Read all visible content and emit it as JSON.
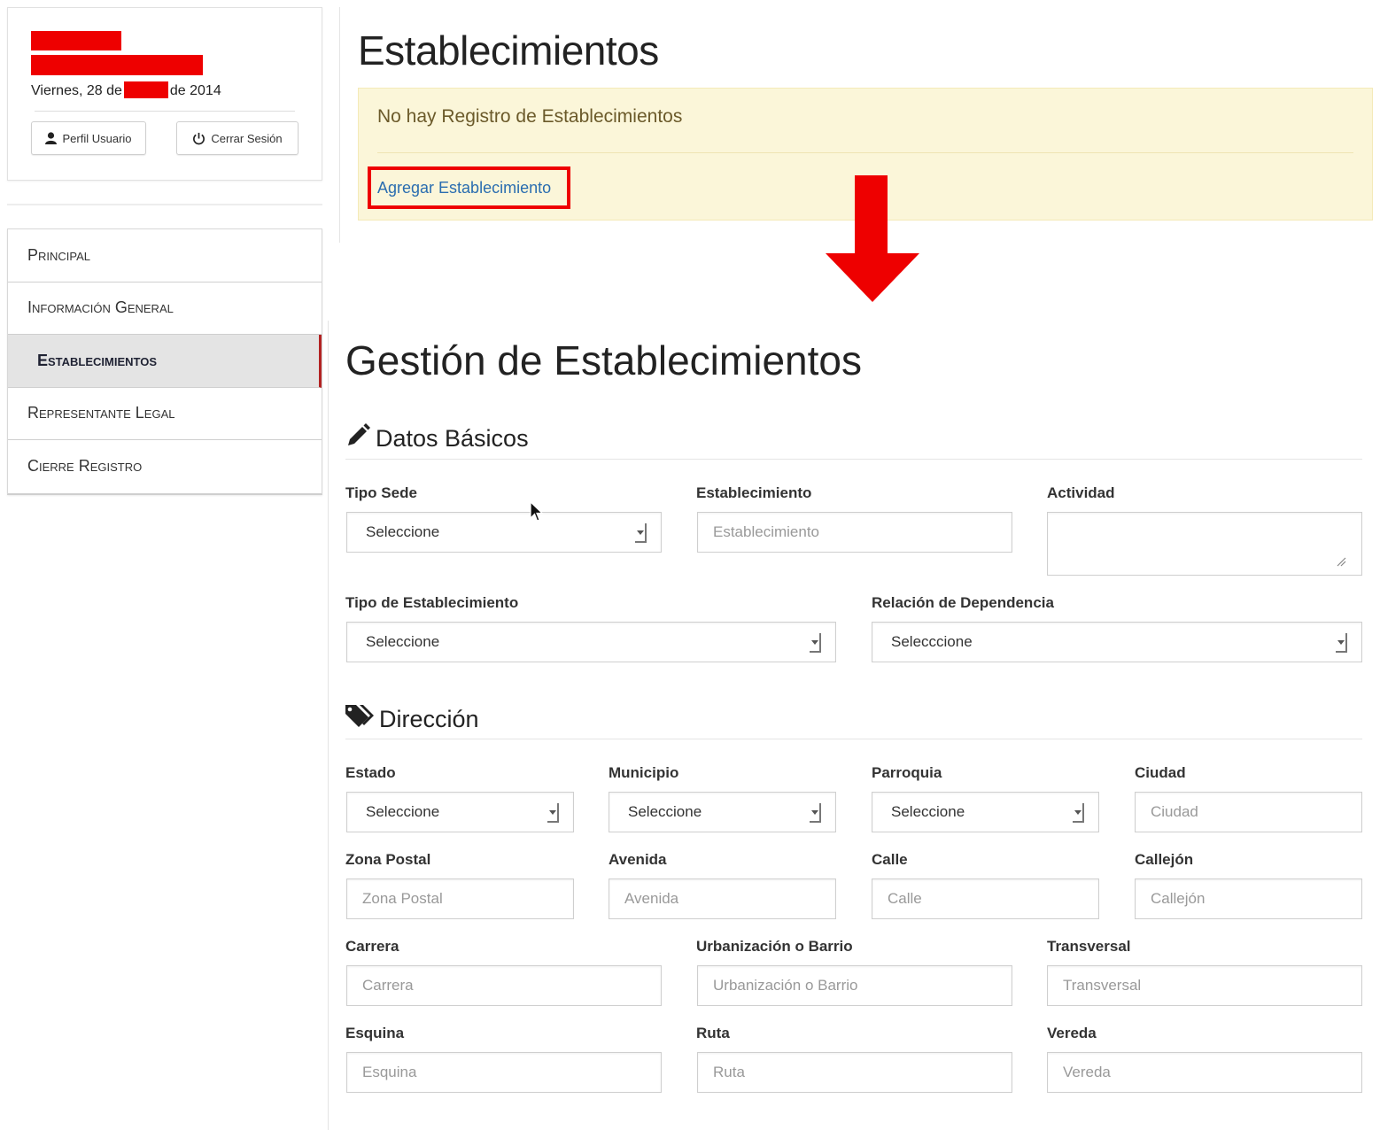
{
  "user_panel": {
    "date_prefix": "Viernes, 28 de",
    "date_suffix": "de 2014",
    "profile_button": "Perfil Usuario",
    "logout_button": "Cerrar Sesión"
  },
  "nav": {
    "items": [
      {
        "label": "Principal"
      },
      {
        "label": "Información General"
      },
      {
        "label": "Establecimientos"
      },
      {
        "label": "Representante Legal"
      },
      {
        "label": "Cierre Registro"
      }
    ]
  },
  "top": {
    "title": "Establecimientos",
    "alert_text": "No hay Registro de Establecimientos",
    "add_link": "Agregar Establecimiento"
  },
  "form": {
    "title": "Gestión de Establecimientos",
    "datos_basicos": {
      "heading": "Datos Básicos",
      "tipo_sede": {
        "label": "Tipo Sede",
        "value": "Seleccione"
      },
      "establecimiento": {
        "label": "Establecimiento",
        "placeholder": "Establecimiento"
      },
      "actividad": {
        "label": "Actividad"
      },
      "tipo_establecimiento": {
        "label": "Tipo de Establecimiento",
        "value": "Seleccione"
      },
      "relacion_dependencia": {
        "label": "Relación de Dependencia",
        "value": "Selecccione"
      }
    },
    "direccion": {
      "heading": "Dirección",
      "estado": {
        "label": "Estado",
        "value": "Seleccione"
      },
      "municipio": {
        "label": "Municipio",
        "value": "Seleccione"
      },
      "parroquia": {
        "label": "Parroquia",
        "value": "Seleccione"
      },
      "ciudad": {
        "label": "Ciudad",
        "placeholder": "Ciudad"
      },
      "zona_postal": {
        "label": "Zona Postal",
        "placeholder": "Zona Postal"
      },
      "avenida": {
        "label": "Avenida",
        "placeholder": "Avenida"
      },
      "calle": {
        "label": "Calle",
        "placeholder": "Calle"
      },
      "callejon": {
        "label": "Callejón",
        "placeholder": "Callejón"
      },
      "carrera": {
        "label": "Carrera",
        "placeholder": "Carrera"
      },
      "urbanizacion": {
        "label": "Urbanización o Barrio",
        "placeholder": "Urbanización o Barrio"
      },
      "transversal": {
        "label": "Transversal",
        "placeholder": "Transversal"
      },
      "esquina": {
        "label": "Esquina",
        "placeholder": "Esquina"
      },
      "ruta": {
        "label": "Ruta",
        "placeholder": "Ruta"
      },
      "vereda": {
        "label": "Vereda",
        "placeholder": "Vereda"
      }
    }
  },
  "colors": {
    "redaction": "#ee0000",
    "alert_bg": "#fbf6d9",
    "link": "#2a6db0",
    "nav_active_border": "#b22222"
  },
  "icons": {
    "profile": "user-icon",
    "logout": "power-icon",
    "datos_basicos": "pencil-icon",
    "direccion": "tags-icon",
    "arrow": "arrow-down-icon"
  }
}
